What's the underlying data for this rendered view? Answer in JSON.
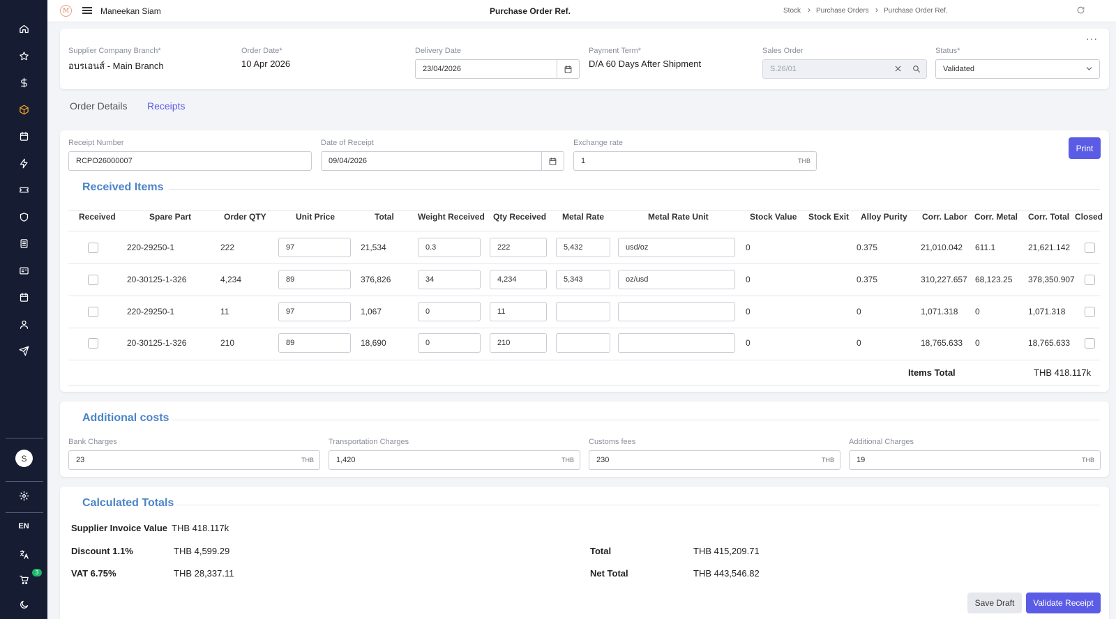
{
  "header": {
    "logo_letter": "M",
    "company": "Maneekan Siam",
    "title": "Purchase Order Ref.",
    "breadcrumb": [
      "Stock",
      "Purchase Orders",
      "Purchase Order Ref."
    ]
  },
  "sidebar": {
    "icons": [
      "home-icon",
      "star-icon",
      "dollar-icon",
      "box-icon",
      "calendar-icon",
      "bolt-icon",
      "ticket-icon",
      "shield-icon",
      "document-icon",
      "id-card-icon",
      "calendar-icon",
      "user-icon",
      "send-icon"
    ],
    "active": "box-icon",
    "avatar_letter": "S",
    "language": "EN",
    "cart_count": "3",
    "active_color": "#f5a623"
  },
  "order": {
    "supplier_label": "Supplier Company Branch*",
    "supplier_value": "อบรเอนส์ - Main Branch",
    "order_date_label": "Order Date*",
    "order_date_value": "10 Apr 2026",
    "delivery_date_label": "Delivery Date",
    "delivery_date_value": "23/04/2026",
    "payment_term_label": "Payment Term*",
    "payment_term_value": "D/A 60 Days After Shipment",
    "sales_order_label": "Sales Order",
    "sales_order_value": "S.26/01",
    "status_label": "Status*",
    "status_value": "Validated"
  },
  "tabs": [
    "Order Details",
    "Receipts"
  ],
  "active_tab": "Receipts",
  "receipt": {
    "number_label": "Receipt Number",
    "number_value": "RCPO26000007",
    "date_label": "Date of Receipt",
    "date_value": "09/04/2026",
    "exchange_label": "Exchange rate",
    "exchange_value": "1",
    "exchange_unit": "THB",
    "print_label": "Print"
  },
  "received_items": {
    "title": "Received Items",
    "columns": [
      "Received",
      "Spare Part",
      "Order QTY",
      "Unit Price",
      "Total",
      "Weight Received",
      "Qty Received",
      "Metal Rate",
      "Metal Rate Unit",
      "Stock Value",
      "Stock Exit",
      "Alloy Purity",
      "Corr. Labor",
      "Corr. Metal",
      "Corr. Total",
      "Closed"
    ],
    "rows": [
      {
        "spare_part": "220-29250-1",
        "order_qty": "222",
        "unit_price": "97",
        "total": "21,534",
        "weight": "0.3",
        "qty_received": "222",
        "metal_rate": "5,432",
        "metal_rate_unit": "usd/oz",
        "stock_value": "0",
        "stock_exit": "",
        "alloy_purity": "0.375",
        "corr_labor": "21,010.042",
        "corr_metal": "611.1",
        "corr_total": "21,621.142"
      },
      {
        "spare_part": "20-30125-1-326",
        "order_qty": "4,234",
        "unit_price": "89",
        "total": "376,826",
        "weight": "34",
        "qty_received": "4,234",
        "metal_rate": "5,343",
        "metal_rate_unit": "oz/usd",
        "stock_value": "0",
        "stock_exit": "",
        "alloy_purity": "0.375",
        "corr_labor": "310,227.657",
        "corr_metal": "68,123.25",
        "corr_total": "378,350.907"
      },
      {
        "spare_part": "220-29250-1",
        "order_qty": "11",
        "unit_price": "97",
        "total": "1,067",
        "weight": "0",
        "qty_received": "11",
        "metal_rate": "",
        "metal_rate_unit": "",
        "stock_value": "0",
        "stock_exit": "",
        "alloy_purity": "0",
        "corr_labor": "1,071.318",
        "corr_metal": "0",
        "corr_total": "1,071.318"
      },
      {
        "spare_part": "20-30125-1-326",
        "order_qty": "210",
        "unit_price": "89",
        "total": "18,690",
        "weight": "0",
        "qty_received": "210",
        "metal_rate": "",
        "metal_rate_unit": "",
        "stock_value": "0",
        "stock_exit": "",
        "alloy_purity": "0",
        "corr_labor": "18,765.633",
        "corr_metal": "0",
        "corr_total": "18,765.633"
      }
    ],
    "items_total_label": "Items Total",
    "items_total_value": "THB 418.117k"
  },
  "additional_costs": {
    "title": "Additional costs",
    "fields": [
      {
        "label": "Bank Charges",
        "value": "23",
        "unit": "THB"
      },
      {
        "label": "Transportation Charges",
        "value": "1,420",
        "unit": "THB"
      },
      {
        "label": "Customs fees",
        "value": "230",
        "unit": "THB"
      },
      {
        "label": "Additional Charges",
        "value": "19",
        "unit": "THB"
      }
    ]
  },
  "totals": {
    "title": "Calculated Totals",
    "supplier_invoice_label": "Supplier Invoice Value",
    "supplier_invoice_value": "THB 418.117k",
    "discount_label": "Discount 1.1%",
    "discount_value": "THB 4,599.29",
    "vat_label": "VAT 6.75%",
    "vat_value": "THB 28,337.11",
    "total_label": "Total",
    "total_value": "THB 415,209.71",
    "net_total_label": "Net Total",
    "net_total_value": "THB 443,546.82"
  },
  "actions": {
    "save_draft": "Save Draft",
    "validate": "Validate Receipt"
  },
  "colors": {
    "accent": "#5b5ce6",
    "section_title": "#4b84c8",
    "sidebar_bg": "#161d33"
  }
}
